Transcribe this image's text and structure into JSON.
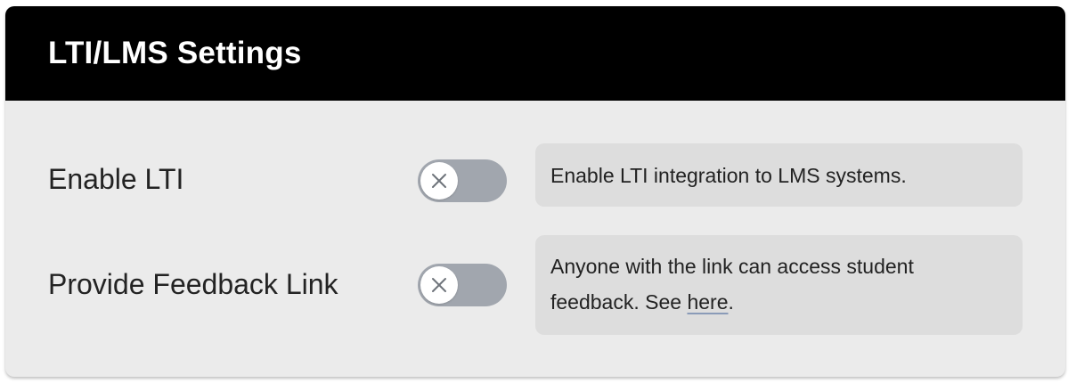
{
  "card": {
    "title": "LTI/LMS Settings"
  },
  "settings": [
    {
      "label": "Enable LTI",
      "toggle_state": "off",
      "toggle_icon": "x-icon",
      "description": "Enable LTI integration to LMS systems."
    },
    {
      "label": "Provide Feedback Link",
      "toggle_state": "off",
      "toggle_icon": "x-icon",
      "description_prefix": "Anyone with the link can access student feedback. See ",
      "description_link": "here",
      "description_suffix": "."
    }
  ],
  "colors": {
    "header_bg": "#000000",
    "card_bg": "#ebebeb",
    "description_bg": "#dddddd",
    "toggle_off_bg": "#a1a6ae"
  }
}
